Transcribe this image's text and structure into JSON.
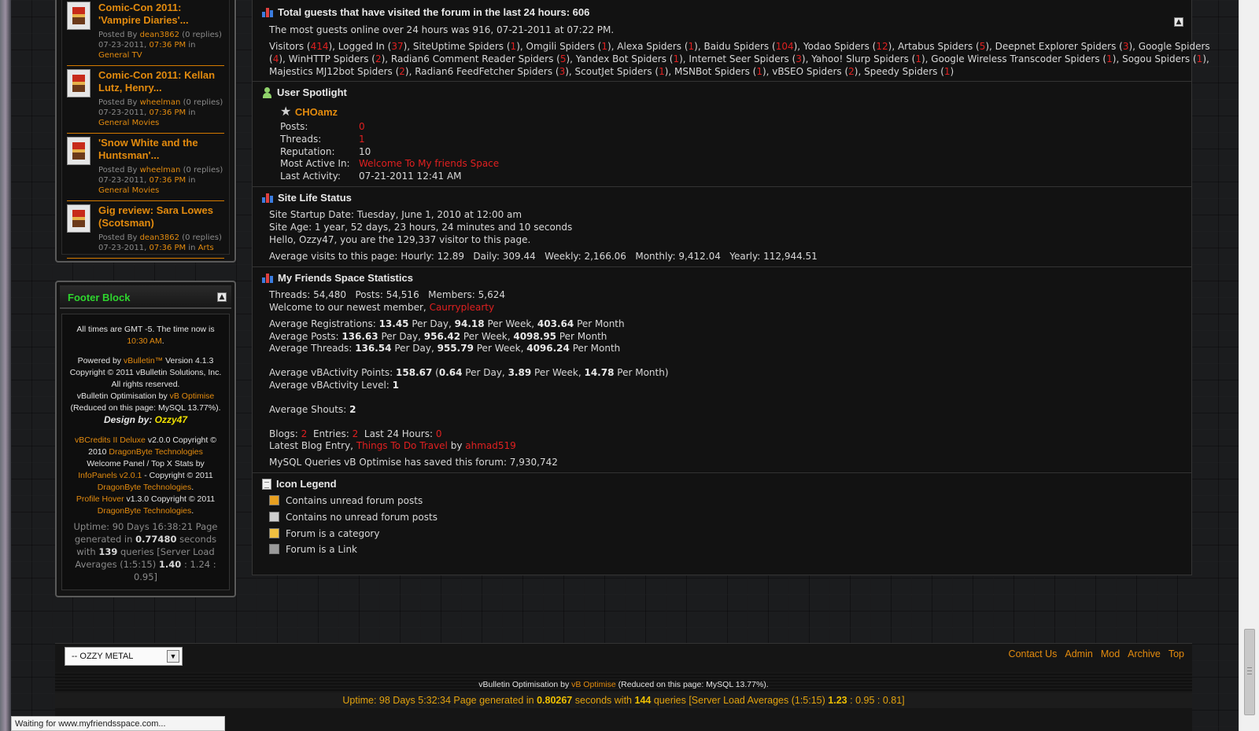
{
  "sidebar": {
    "recent_posts": [
      {
        "title": "Comic-Con 2011: 'Vampire Diaries'...",
        "posted_by": "Posted By",
        "user": "dean3862",
        "replies": "(0 replies)",
        "date": "07-23-2011,",
        "time": "07:36 PM",
        "in": "in",
        "category": "General TV"
      },
      {
        "title": "Comic-Con 2011: Kellan Lutz, Henry...",
        "posted_by": "Posted By",
        "user": "wheelman",
        "replies": "(0 replies)",
        "date": "07-23-2011,",
        "time": "07:36 PM",
        "in": "in",
        "category": "General Movies"
      },
      {
        "title": "'Snow White and the Huntsman'...",
        "posted_by": "Posted By",
        "user": "wheelman",
        "replies": "(0 replies)",
        "date": "07-23-2011,",
        "time": "07:36 PM",
        "in": "in",
        "category": "General Movies"
      },
      {
        "title": "Gig review: Sara Lowes (Scotsman)",
        "posted_by": "Posted By",
        "user": "dean3862",
        "replies": "(0 replies)",
        "date": "07-23-2011,",
        "time": "07:36 PM",
        "in": "in",
        "category": "Arts"
      }
    ],
    "footer_block": {
      "title": "Footer Block",
      "collapse": "▲",
      "tz_text": "All times are GMT -5. The time now is",
      "time_now": "10:30 AM",
      "powered_pre": "Powered by",
      "vbulletin": "vBulletin™",
      "version": "Version 4.1.3",
      "copyright": "Copyright © 2011 vBulletin Solutions, Inc. All rights reserved.",
      "optimisation_pre": "vBulletin Optimisation by",
      "vb_optimise": "vB Optimise",
      "reduced": "(Reduced on this page: MySQL 13.77%).",
      "design_pre": "Design by:",
      "designer": "Ozzy47",
      "vbcredits": "vBCredits II Deluxe",
      "vbcredits_rest": "v2.0.0 Copyright © 2010",
      "dragonbyte": "DragonByte Technologies",
      "welcome_panel": "Welcome Panel / Top X Stats by",
      "infopanels": "InfoPanels v2.0.1",
      "infopanels_rest": "- Copyright © 2011",
      "dragonbyte2": "DragonByte Technologies",
      "profile_hover": "Profile Hover",
      "profile_hover_rest": "v1.3.0 Copyright © 2011",
      "dragonbyte3": "DragonByte Technologies",
      "uptime_pre": "Uptime: 90 Days 16:38:21 Page generated in",
      "gen_time": "0.77480",
      "seconds_with": "seconds with",
      "queries": "139",
      "queries_rest": "queries [Server Load Averages (1:5:15)",
      "load1": "1.40",
      "load_rest": ": 1.24 : 0.95]"
    }
  },
  "main": {
    "guests": {
      "title": "Total guests that have visited the forum in the last 24 hours: 606",
      "collapse": "▲",
      "most": "The most guests online over 24 hours was 916, 07-21-2011 at 07:22 PM.",
      "line1": [
        {
          "t": "Visitors ("
        },
        {
          "t": "414",
          "r": 1
        },
        {
          "t": "), Logged In ("
        },
        {
          "t": "37",
          "r": 1
        },
        {
          "t": "), SiteUptime Spiders ("
        },
        {
          "t": "1",
          "r": 1
        },
        {
          "t": "), Omgili Spiders ("
        },
        {
          "t": "1",
          "r": 1
        },
        {
          "t": "), Alexa Spiders ("
        },
        {
          "t": "1",
          "r": 1
        },
        {
          "t": "), Baidu Spiders ("
        },
        {
          "t": "104",
          "r": 1
        },
        {
          "t": "), Yodao Spiders ("
        },
        {
          "t": "12",
          "r": 1
        },
        {
          "t": "), Artabus Spiders ("
        },
        {
          "t": "5",
          "r": 1
        },
        {
          "t": "), Deepnet Explorer Spiders ("
        },
        {
          "t": "3",
          "r": 1
        },
        {
          "t": "), Google Spiders"
        }
      ],
      "line2": [
        {
          "t": "("
        },
        {
          "t": "4",
          "r": 1
        },
        {
          "t": "), WinHTTP Spiders ("
        },
        {
          "t": "2",
          "r": 1
        },
        {
          "t": "), Radian6 Comment Reader Spiders ("
        },
        {
          "t": "5",
          "r": 1
        },
        {
          "t": "), Yandex Bot Spiders ("
        },
        {
          "t": "1",
          "r": 1
        },
        {
          "t": "), Internet Seer Spiders ("
        },
        {
          "t": "3",
          "r": 1
        },
        {
          "t": "), Yahoo! Slurp Spiders ("
        },
        {
          "t": "1",
          "r": 1
        },
        {
          "t": "), Google Wireless Transcoder Spiders ("
        },
        {
          "t": "1",
          "r": 1
        },
        {
          "t": "), Sogou Spiders ("
        },
        {
          "t": "1",
          "r": 1
        },
        {
          "t": "),"
        }
      ],
      "line3": [
        {
          "t": "Majestics MJ12bot Spiders ("
        },
        {
          "t": "2",
          "r": 1
        },
        {
          "t": "), Radian6 FeedFetcher Spiders ("
        },
        {
          "t": "3",
          "r": 1
        },
        {
          "t": "), ScoutJet Spiders ("
        },
        {
          "t": "1",
          "r": 1
        },
        {
          "t": "), MSNBot Spiders ("
        },
        {
          "t": "1",
          "r": 1
        },
        {
          "t": "), vBSEO Spiders ("
        },
        {
          "t": "2",
          "r": 1
        },
        {
          "t": "), Speedy Spiders ("
        },
        {
          "t": "1",
          "r": 1
        },
        {
          "t": ")"
        }
      ]
    },
    "spotlight": {
      "title": "User Spotlight",
      "username": "CHOamz",
      "posts_label": "Posts:",
      "posts": "0",
      "threads_label": "Threads:",
      "threads": "1",
      "rep_label": "Reputation:",
      "rep": "10",
      "active_label": "Most Active In:",
      "active": "Welcome To My friends Space",
      "last_label": "Last Activity:",
      "last": "07-21-2011 12:41 AM"
    },
    "life": {
      "title": "Site Life Status",
      "startup": "Site Startup Date: Tuesday, June 1, 2010 at 12:00 am",
      "age": "Site Age: 1 year, 52 days, 23 hours, 24 minutes and 10 seconds",
      "hello": "Hello, Ozzy47, you are the 129,337 visitor to this page.",
      "averages": "Average visits to this page: Hourly: 12.89   Daily: 309.44   Weekly: 2,166.06   Monthly: 9,412.04   Yearly: 112,944.51"
    },
    "stats": {
      "title": "My Friends Space Statistics",
      "counts": "Threads: 54,480   Posts: 54,516   Members: 5,624",
      "welcome": "Welcome to our newest member,",
      "newest": "Caurryplearty",
      "reg_label": "Average Registrations:",
      "reg_day": "13.45",
      "reg_week": "94.18",
      "reg_month": "403.64",
      "posts_label": "Average Posts:",
      "posts_day": "136.63",
      "posts_week": "956.42",
      "posts_month": "4098.95",
      "threads_label": "Average Threads:",
      "threads_day": "136.54",
      "threads_week": "955.79",
      "threads_month": "4096.24",
      "per_day": "Per Day,",
      "per_week": "Per Week,",
      "per_month": "Per Month",
      "vba_label": "Average vBActivity Points:",
      "vba_points": "158.67",
      "vba_day": "0.64",
      "vba_week": "3.89",
      "vba_month": "14.78",
      "vba_day_l": "Per Day,",
      "vba_week_l": "Per Week,",
      "vba_month_l": "Per Month)",
      "vbl_label": "Average vBActivity Level:",
      "vbl": "1",
      "shouts_label": "Average Shouts:",
      "shouts": "2",
      "blogs_label": "Blogs:",
      "blogs": "2",
      "entries_label": "Entries:",
      "entries": "2",
      "last24_label": "Last 24 Hours:",
      "last24": "0",
      "latest_label": "Latest Blog Entry,",
      "latest": "Things To Do Travel",
      "by": "by",
      "author": "ahmad519",
      "mysql": "MySQL Queries vB Optimise has saved this forum: 7,930,742"
    },
    "legend": {
      "title": "Icon Legend",
      "items": [
        "Contains unread forum posts",
        "Contains no unread forum posts",
        "Forum is a category",
        "Forum is a Link"
      ]
    }
  },
  "footer": {
    "style_select": "-- OZZY METAL",
    "select_arrow": "▼",
    "links": [
      "Contact Us",
      "Admin",
      "Mod",
      "Archive",
      "Top"
    ],
    "optimise_pre": "vBulletin Optimisation by",
    "optimise_link": "vB Optimise",
    "optimise_post": "(Reduced on this page: MySQL 13.77%).",
    "uptime_pre": "Uptime: 98 Days 5:32:34 Page generated in",
    "gen": "0.80267",
    "mid": "seconds with",
    "queries": "144",
    "q_rest": "queries [Server Load Averages (1:5:15)",
    "l1": "1.23",
    "l_rest": ": 0.95 : 0.81]"
  },
  "browser": {
    "status": "Waiting for www.myfriendsspace.com..."
  },
  "colors": {
    "accent": "#e38b0e",
    "highlight": "#e02020",
    "footer_title": "#2ed52e"
  }
}
